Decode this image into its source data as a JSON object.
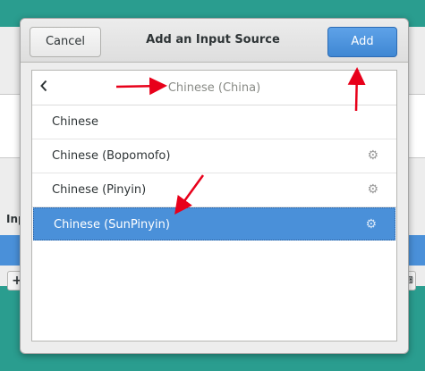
{
  "dialog": {
    "title": "Add an Input Source",
    "cancel_label": "Cancel",
    "add_label": "Add"
  },
  "list": {
    "header_title": "Chinese (China)",
    "items": [
      {
        "label": "Chinese",
        "has_settings": false,
        "selected": false
      },
      {
        "label": "Chinese (Bopomofo)",
        "has_settings": true,
        "selected": false
      },
      {
        "label": "Chinese (Pinyin)",
        "has_settings": true,
        "selected": false
      },
      {
        "label": "Chinese (SunPinyin)",
        "has_settings": true,
        "selected": true
      }
    ]
  },
  "background_window": {
    "section_heading_partial": "Inp",
    "add_button": "+"
  },
  "icons": {
    "back": "chevron-left-icon",
    "settings": "gear-icon"
  },
  "colors": {
    "desktop": "#2a9d8f",
    "accent": "#4a90d9",
    "annotation": "#e8001a"
  }
}
